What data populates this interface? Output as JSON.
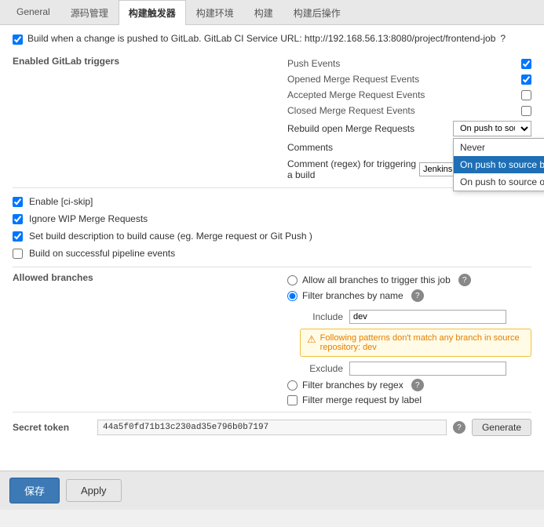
{
  "tabs": [
    {
      "label": "General",
      "active": false
    },
    {
      "label": "源码管理",
      "active": false
    },
    {
      "label": "构建触发器",
      "active": true
    },
    {
      "label": "构建环境",
      "active": false
    },
    {
      "label": "构建",
      "active": false
    },
    {
      "label": "构建后操作",
      "active": false
    }
  ],
  "top_notice": {
    "checkbox": true,
    "text": "Build when a change is pushed to GitLab. GitLab CI Service URL: http://192.168.56.13:8080/project/frontend-job",
    "help": "?"
  },
  "gitlab_triggers_label": "Enabled GitLab triggers",
  "events": [
    {
      "label": "Push Events",
      "checked": true
    },
    {
      "label": "Opened Merge Request Events",
      "checked": true
    },
    {
      "label": "Accepted Merge Request Events",
      "checked": false
    },
    {
      "label": "Closed Merge Request Events",
      "checked": false
    }
  ],
  "rebuild": {
    "label": "Rebuild open Merge Requests",
    "select_value": "On push to s",
    "options": [
      {
        "label": "Never",
        "value": "never"
      },
      {
        "label": "On push to source branch",
        "value": "source",
        "selected": true
      },
      {
        "label": "On push to source or target br",
        "value": "both"
      }
    ]
  },
  "comments": {
    "label": "Comments",
    "checked": false
  },
  "comment_regex": {
    "label": "Comment (regex) for triggering a build",
    "value": "Jenkins please r",
    "help": "?"
  },
  "options": [
    {
      "label": "Enable [ci-skip]",
      "checked": true
    },
    {
      "label": "Ignore WIP Merge Requests",
      "checked": true
    },
    {
      "label": "Set build description to build cause (eg. Merge request or Git Push )",
      "checked": true
    },
    {
      "label": "Build on successful pipeline events",
      "checked": false
    }
  ],
  "allowed_branches": {
    "label": "Allowed branches",
    "options": [
      {
        "label": "Allow all branches to trigger this job",
        "value": "all",
        "selected": false,
        "help": true
      },
      {
        "label": "Filter branches by name",
        "value": "name",
        "selected": true,
        "help": true
      },
      {
        "label": "Filter branches by regex",
        "value": "regex",
        "selected": false,
        "help": true
      },
      {
        "label": "Filter merge request by label",
        "value": "label",
        "selected": false
      }
    ],
    "include_label": "Include",
    "include_value": "dev",
    "exclude_label": "Exclude",
    "exclude_value": "",
    "warning_text": "Following patterns don't match any branch in source repository: dev"
  },
  "secret_token": {
    "label": "Secret token",
    "value": "44a5f0fd71b13c230ad35e796b0b7197",
    "help": "?",
    "generate_label": "Generate"
  },
  "bottom_bar": {
    "save_label": "保存",
    "apply_label": "Apply"
  }
}
